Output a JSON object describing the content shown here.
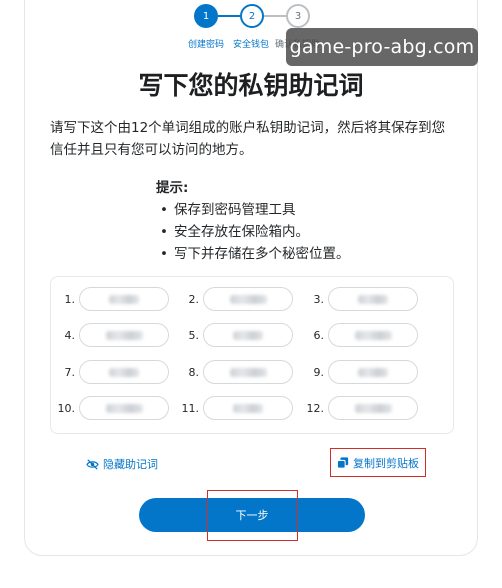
{
  "stepper": {
    "steps": [
      {
        "number": "1",
        "label": "创建密码"
      },
      {
        "number": "2",
        "label": "安全钱包"
      },
      {
        "number": "3",
        "label": "确认私钥助"
      }
    ]
  },
  "watermark": "game-pro-abg.com",
  "page": {
    "title": "写下您的私钥助记词",
    "description": "请写下这个由12个单词组成的账户私钥助记词，然后将其保存到您信任并且只有您可以访问的地方。"
  },
  "tips": {
    "title": "提示:",
    "items": [
      "保存到密码管理工具",
      "安全存放在保险箱内。",
      "写下并存储在多个秘密位置。"
    ]
  },
  "words": [
    {
      "num": "1."
    },
    {
      "num": "2."
    },
    {
      "num": "3."
    },
    {
      "num": "4."
    },
    {
      "num": "5."
    },
    {
      "num": "6."
    },
    {
      "num": "7."
    },
    {
      "num": "8."
    },
    {
      "num": "9."
    },
    {
      "num": "10."
    },
    {
      "num": "11."
    },
    {
      "num": "12."
    }
  ],
  "actions": {
    "hide_label": "隐藏助记词",
    "copy_label": "复制到剪贴板"
  },
  "next_label": "下一步",
  "colors": {
    "primary": "#0376c9",
    "highlight": "#d0302a"
  }
}
